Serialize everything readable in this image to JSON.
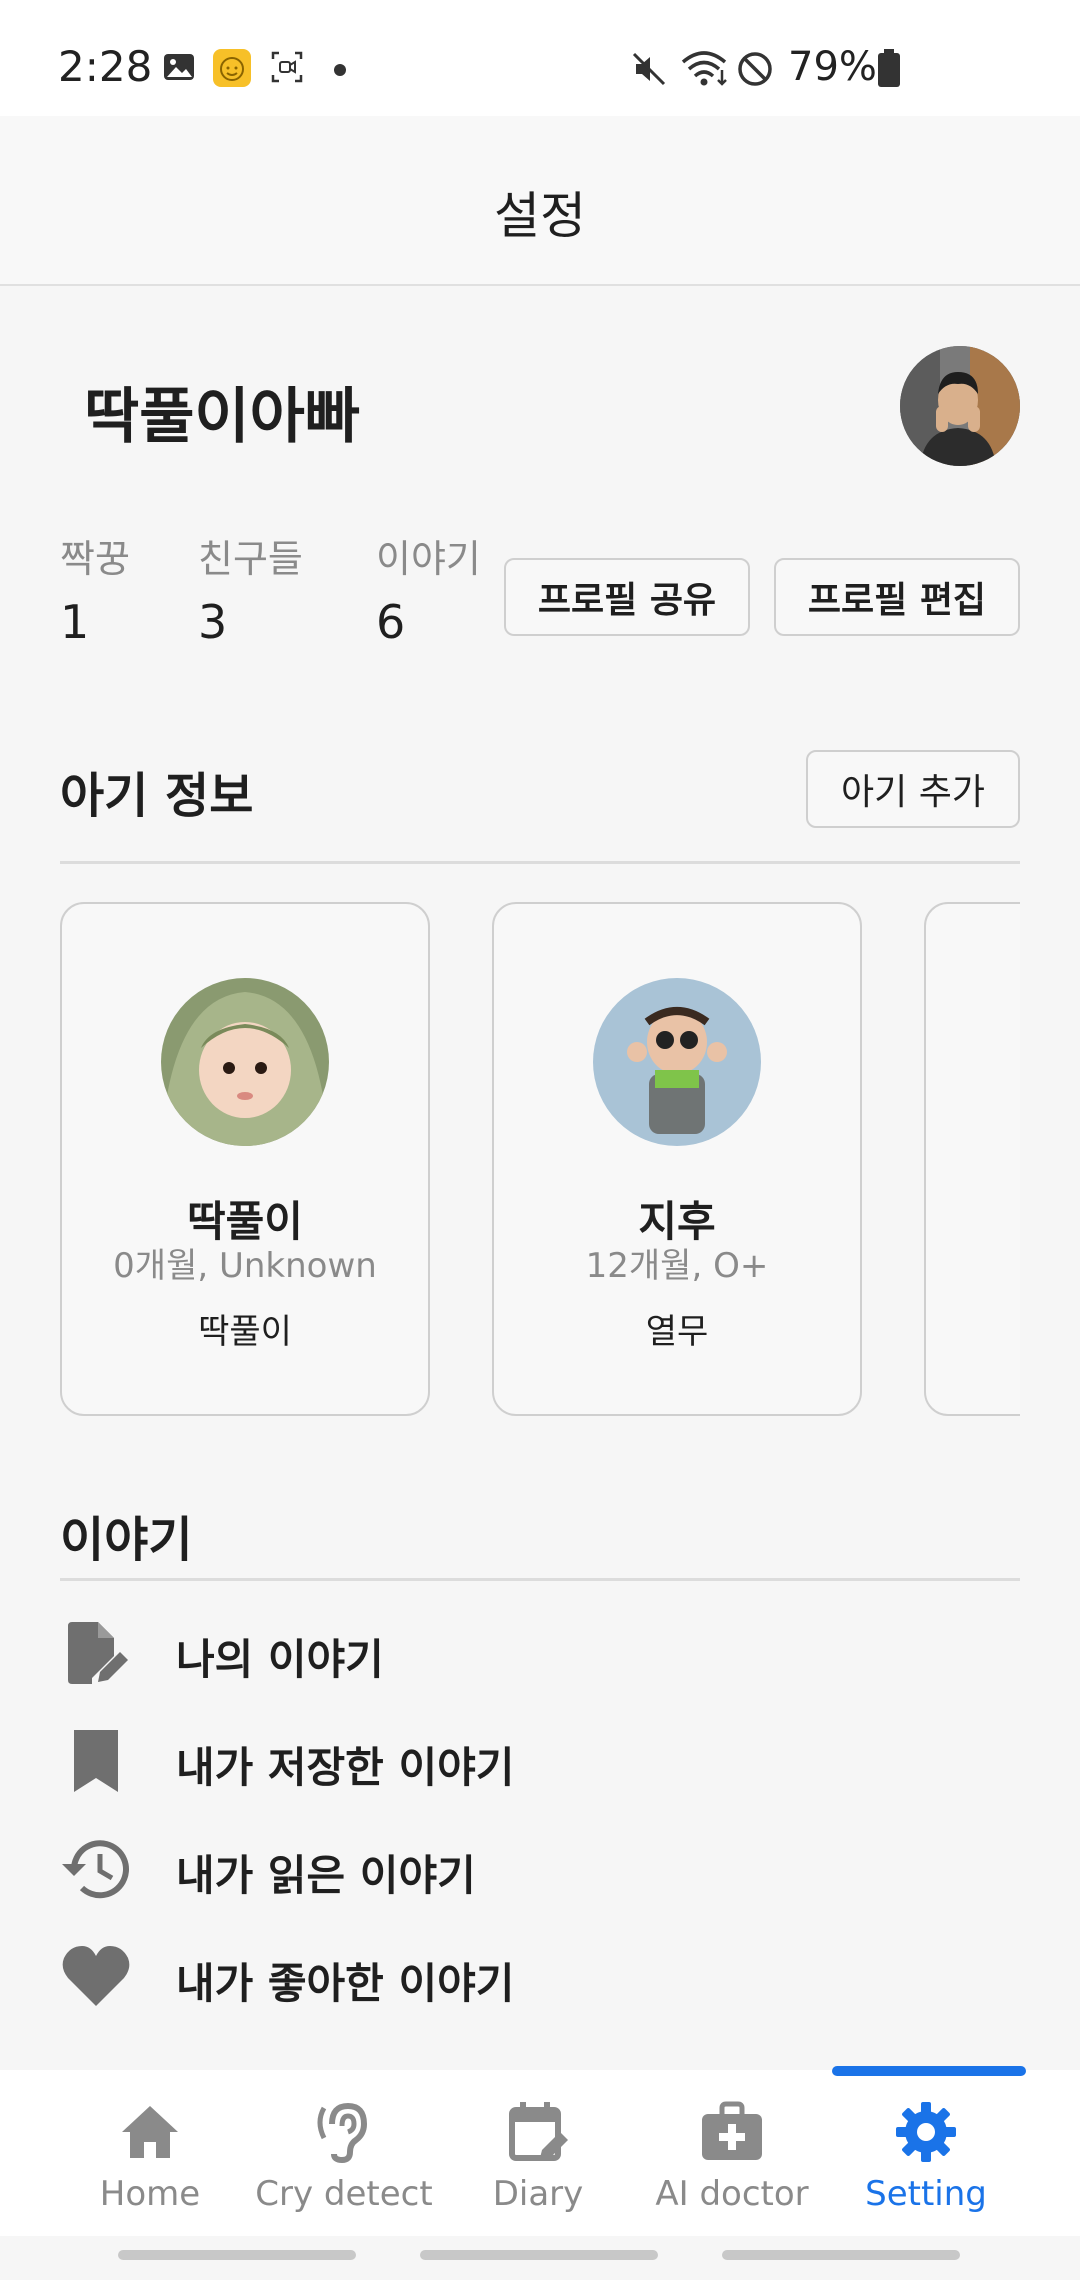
{
  "status_bar": {
    "time": "2:28",
    "battery": "79%"
  },
  "header": {
    "title": "설정"
  },
  "profile": {
    "name": "딱풀이아빠",
    "stats": [
      {
        "label": "짝꿍",
        "value": "1"
      },
      {
        "label": "친구들",
        "value": "3"
      },
      {
        "label": "이야기",
        "value": "6"
      }
    ],
    "share_button": "프로필 공유",
    "edit_button": "프로필 편집"
  },
  "baby_section": {
    "title": "아기 정보",
    "add_button": "아기 추가",
    "babies": [
      {
        "name": "딱풀이",
        "meta": "0개월, Unknown",
        "nickname": "딱풀이"
      },
      {
        "name": "지후",
        "meta": "12개월, O+",
        "nickname": "열무"
      }
    ]
  },
  "story_section": {
    "title": "이야기",
    "items": [
      {
        "label": "나의 이야기",
        "icon": "edit-document-icon"
      },
      {
        "label": "내가 저장한 이야기",
        "icon": "bookmark-icon"
      },
      {
        "label": "내가 읽은 이야기",
        "icon": "history-icon"
      },
      {
        "label": "내가 좋아한 이야기",
        "icon": "heart-icon"
      }
    ]
  },
  "bottom_nav": {
    "active": "Setting",
    "accent_color": "#1a73e8",
    "items": [
      {
        "label": "Home",
        "icon": "home-icon"
      },
      {
        "label": "Cry detect",
        "icon": "ear-icon"
      },
      {
        "label": "Diary",
        "icon": "calendar-edit-icon"
      },
      {
        "label": "AI doctor",
        "icon": "medical-bag-icon"
      },
      {
        "label": "Setting",
        "icon": "gear-icon"
      }
    ]
  }
}
